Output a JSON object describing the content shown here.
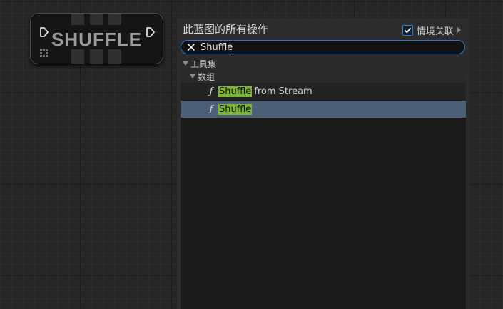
{
  "node": {
    "title": "SHUFFLE",
    "exec_in_icon": "exec-pin-icon",
    "exec_out_icon": "exec-pin-icon",
    "grip_icon": "grid-dots-icon",
    "colors": {
      "background": "#151515",
      "stripe": "#303030",
      "title": "#9b9b9b"
    }
  },
  "menu": {
    "title": "此蓝图的所有操作",
    "context_sensitive": {
      "label": "情境关联",
      "checked": true,
      "icon": "checkbox-checked-icon"
    },
    "search": {
      "value": "Shuffle",
      "clear_icon": "close-icon"
    },
    "tree": {
      "categories": [
        {
          "label": "工具集",
          "expanded": true
        },
        {
          "label": "数组",
          "expanded": true
        }
      ],
      "items": [
        {
          "icon": "function-icon",
          "match": "Shuffle",
          "rest": "from Stream",
          "selected": false
        },
        {
          "icon": "function-icon",
          "match": "Shuffle",
          "rest": "",
          "selected": true
        }
      ]
    },
    "colors": {
      "accent": "#2e7ad0",
      "highlight": "#7cb437",
      "selected_row": "#4c5f76",
      "panel": "#2c2c2c"
    }
  }
}
